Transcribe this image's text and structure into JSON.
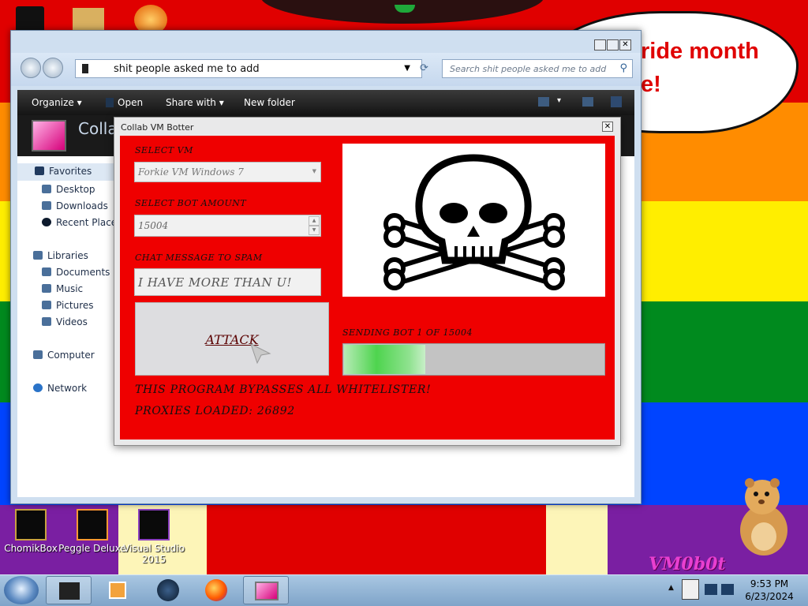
{
  "desktop": {
    "bubble_lines": [
      "ride month",
      "e!"
    ],
    "icons": [
      {
        "label": "ChomikBox"
      },
      {
        "label": "Peggle Deluxe"
      },
      {
        "label": "Visual Studio 2015"
      }
    ],
    "watermark": "VM0b0t",
    "stripe_colors": [
      "#e00000",
      "#ff8c00",
      "#ffee00",
      "#008a1e",
      "#0044ff",
      "#7a1fa2"
    ]
  },
  "explorer": {
    "address": "shit people asked me to add",
    "search_placeholder": "Search shit people asked me to add",
    "toolbar": {
      "organize": "Organize",
      "open": "Open",
      "share_with": "Share with",
      "new_folder": "New folder"
    },
    "header_title": "Colla",
    "nav": {
      "favorites": "Favorites",
      "desktop": "Desktop",
      "downloads": "Downloads",
      "recent_places": "Recent Places",
      "libraries": "Libraries",
      "documents": "Documents",
      "music": "Music",
      "pictures": "Pictures",
      "videos": "Videos",
      "computer": "Computer",
      "network": "Network"
    }
  },
  "botter": {
    "title": "Collab VM Botter",
    "select_vm_label": "SELECT VM",
    "select_vm_value": "Forkie VM Windows 7",
    "bot_amount_label": "SELECT BOT AMOUNT",
    "bot_amount_value": "15004",
    "chat_label": "CHAT MESSAGE TO SPAM",
    "chat_value": "I HAVE MORE THAN U!",
    "attack_label": "ATTACK",
    "status_text": "SENDING BOT 1 OF 15004",
    "progress_fraction": 0.31,
    "bypass_text": "THIS PROGRAM BYPASSES ALL WHITELISTER!",
    "proxies_text": "PROXIES LOADED: 26892"
  },
  "taskbar": {
    "time": "9:53 PM",
    "date": "6/23/2024"
  }
}
